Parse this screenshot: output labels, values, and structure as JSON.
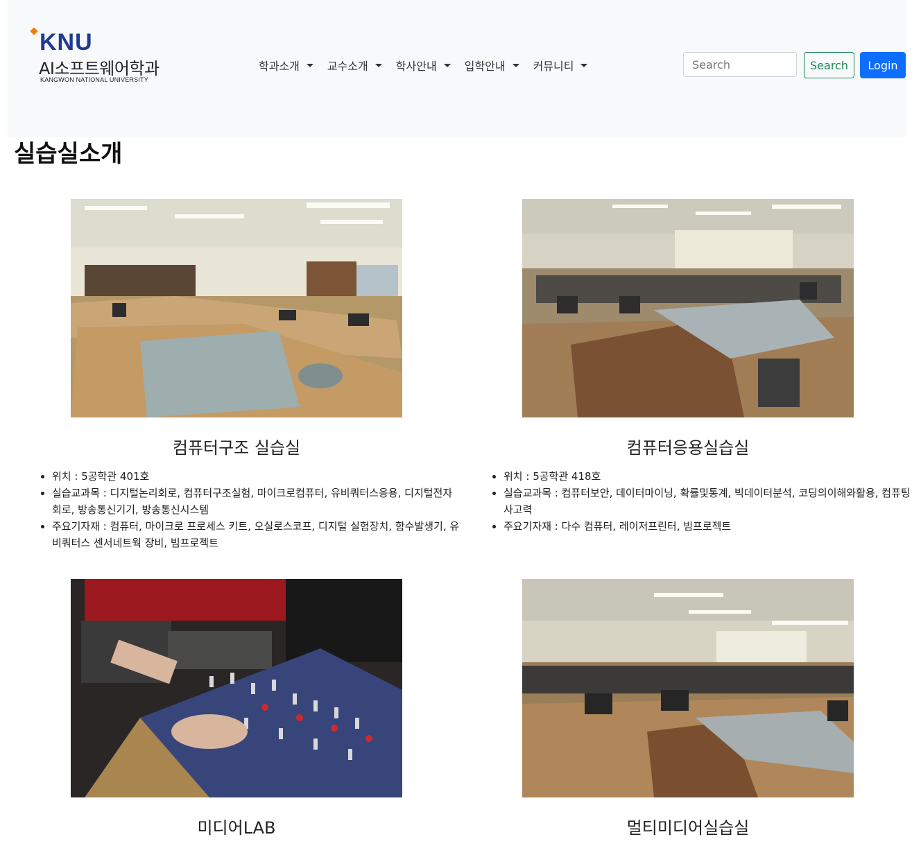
{
  "header": {
    "logo_text": "KNU",
    "department": "AI소프트웨어학과",
    "university": "KANGWON NATIONAL UNIVERSITY",
    "menu": [
      {
        "label": "학과소개"
      },
      {
        "label": "교수소개"
      },
      {
        "label": "학사안내"
      },
      {
        "label": "입학안내"
      },
      {
        "label": "커뮤니티"
      }
    ],
    "search_placeholder": "Search",
    "search_button": "Search",
    "login_button": "Login",
    "colors": {
      "navbar_bg": "#f8f9fa",
      "search_btn": "#198754",
      "login_btn": "#0d6efd",
      "logo": "#1f3a93",
      "logo_accent": "#f07d00"
    }
  },
  "page": {
    "title": "실습실소개"
  },
  "labs": [
    {
      "title": "컴퓨터구조 실습실",
      "photo": "classroom-photo",
      "info": [
        "위치 : 5공학관 401호",
        "실습교과목 : 디지털논리회로, 컴퓨터구조실험, 마이크로컴퓨터, 유비쿼터스응용, 디지털전자회로, 방송통신기기, 방송통신시스템",
        "주요기자재 : 컴퓨터, 마이크로 프로세스 키트, 오실로스코프, 디지털 실험장치, 함수발생기, 유비쿼터스 센서네트웍 장비, 빔프로젝트"
      ]
    },
    {
      "title": "컴퓨터응용실습실",
      "photo": "classroom-photo",
      "info": [
        "위치 : 5공학관 418호",
        "실습교과목 : 컴퓨터보안, 데이터마이닝, 확률및통계, 빅데이터분석, 코딩의이해와활용, 컴퓨팅사고력",
        "주요기자재 : 다수 컴퓨터, 레이저프린터, 빔프로젝트"
      ]
    },
    {
      "title": "미디어LAB",
      "photo": "audio-mixer-photo",
      "info": []
    },
    {
      "title": "멀티미디어실습실",
      "photo": "classroom-photo",
      "info": []
    }
  ]
}
